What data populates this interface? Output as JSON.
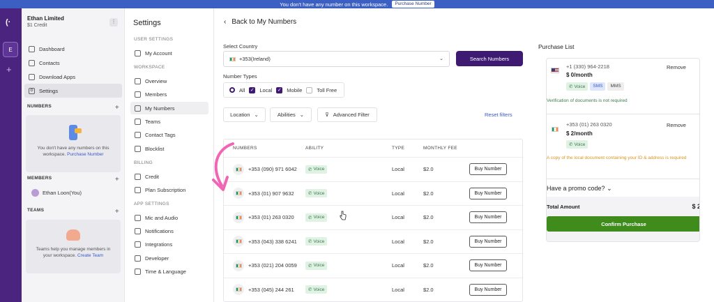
{
  "banner": {
    "text": "You don't have any number on this workspace.",
    "button": "Purchase Number"
  },
  "rail": {
    "workspace_initial": "E"
  },
  "sidebar": {
    "org_name": "Ethan Limited",
    "credit": "$1 Credit",
    "nav": [
      {
        "label": "Dashboard",
        "icon": "dashboard-icon"
      },
      {
        "label": "Contacts",
        "icon": "contacts-icon"
      },
      {
        "label": "Download Apps",
        "icon": "download-icon"
      },
      {
        "label": "Settings",
        "icon": "gear-icon",
        "active": true
      }
    ],
    "numbers_header": "NUMBERS",
    "numbers_empty_text": "You don't have any numbers on this workspace.",
    "numbers_empty_link": "Purchase Number",
    "members_header": "MEMBERS",
    "member_name": "Ethan Loon(You)",
    "teams_header": "TEAMS",
    "teams_text": "Teams help you manage members in your workspace.",
    "teams_link": "Create Team"
  },
  "settings": {
    "title": "Settings",
    "user_settings_label": "USER SETTINGS",
    "workspace_label": "WORKSPACE",
    "billing_label": "BILLING",
    "app_settings_label": "APP SETTINGS",
    "user_items": [
      "My Account"
    ],
    "workspace_items": [
      "Overview",
      "Members",
      "My Numbers",
      "Teams",
      "Contact Tags",
      "Blocklist"
    ],
    "billing_items": [
      "Credit",
      "Plan Subscription"
    ],
    "app_items": [
      "Mic and Audio",
      "Notifications",
      "Integrations",
      "Developer",
      "Time & Language"
    ],
    "active_item": "My Numbers"
  },
  "main": {
    "back_label": "Back to My Numbers",
    "select_country_label": "Select Country",
    "country_value": "+353(Ireland)",
    "search_button": "Search Numbers",
    "number_types_label": "Number Types",
    "types": {
      "all": "All",
      "local": "Local",
      "mobile": "Mobile",
      "toll_free": "Toll Free"
    },
    "filters": {
      "location": "Location",
      "abilities": "Abilities",
      "advanced": "Advanced Filter"
    },
    "reset": "Reset filters",
    "table": {
      "headers": [
        "NUMBERS",
        "ABILITY",
        "TYPE",
        "MONTHLY FEE"
      ],
      "rows": [
        {
          "number": "+353 (090) 971 6042",
          "ability": "Voice",
          "type": "Local",
          "fee": "$2.0",
          "action": "Buy Number"
        },
        {
          "number": "+353 (01) 907 9632",
          "ability": "Voice",
          "type": "Local",
          "fee": "$2.0",
          "action": "Buy Number"
        },
        {
          "number": "+353 (01) 263 0320",
          "ability": "Voice",
          "type": "Local",
          "fee": "$2.0",
          "action": "Buy Number"
        },
        {
          "number": "+353 (043) 338 6241",
          "ability": "Voice",
          "type": "Local",
          "fee": "$2.0",
          "action": "Buy Number"
        },
        {
          "number": "+353 (021) 204 0059",
          "ability": "Voice",
          "type": "Local",
          "fee": "$2.0",
          "action": "Buy Number"
        },
        {
          "number": "+353 (045) 244 261",
          "ability": "Voice",
          "type": "Local",
          "fee": "$2.0",
          "action": "Buy Number"
        }
      ]
    }
  },
  "purchase": {
    "title": "Purchase List",
    "items": [
      {
        "number": "+1 (330) 964-2218",
        "price": "$ 0/month",
        "remove": "Remove",
        "badges": [
          "Voice",
          "SMS",
          "MMS"
        ],
        "note": "Verification of documents is not required",
        "note_color": "#3d7a4e"
      },
      {
        "number": "+353 (01) 263 0320",
        "price": "$ 2/month",
        "remove": "Remove",
        "badges": [
          "Voice"
        ],
        "note": "A copy of the local document containing your ID & address is required",
        "note_color": "#d99520"
      }
    ],
    "promo": "Have a promo code?",
    "total_label": "Total Amount",
    "total_value": "$ 2",
    "confirm": "Confirm Purchase"
  },
  "colors": {
    "rail": "#4b2480",
    "primary": "#3f1a73",
    "confirm": "#3f8b1c",
    "banner": "#3b5fc2",
    "annotation_arrow": "#f065b4"
  }
}
